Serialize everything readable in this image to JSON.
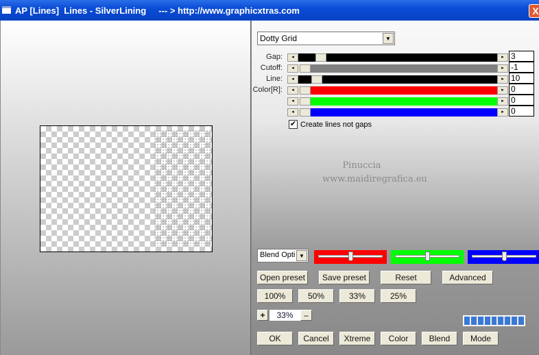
{
  "window": {
    "title": "AP [Lines]  Lines - SilverLining     --- > http://www.graphicxtras.com",
    "close": "X"
  },
  "preset": {
    "value": "Dotty Grid"
  },
  "sliders": [
    {
      "label": "Gap:",
      "value": "3",
      "color": "#000000",
      "thumb_pct": 8
    },
    {
      "label": "Cutoff:",
      "value": "-1",
      "color": "#808080",
      "thumb_pct": 0
    },
    {
      "label": "Line:",
      "value": "10",
      "color": "#000000",
      "thumb_pct": 6
    },
    {
      "label": "Color[R]:",
      "value": "0",
      "color": "#ff0000",
      "thumb_pct": 0
    },
    {
      "label": "",
      "value": "0",
      "color": "#00ff00",
      "thumb_pct": 0
    },
    {
      "label": "",
      "value": "0",
      "color": "#0000ff",
      "thumb_pct": 0
    }
  ],
  "checkbox": {
    "label": "Create lines not gaps",
    "checked": true
  },
  "watermark": {
    "line1": "Pinuccia",
    "line2": "www.maidiregrafica.eu"
  },
  "blend": {
    "value": "Blend Opti"
  },
  "color_sliders": [
    {
      "color": "#ff0000",
      "pct": 50
    },
    {
      "color": "#00ff00",
      "pct": 50
    },
    {
      "color": "#0000ff",
      "pct": 50
    }
  ],
  "buttons": {
    "open_preset": "Open preset",
    "save_preset": "Save preset",
    "reset": "Reset",
    "advanced": "Advanced"
  },
  "zoom_buttons": [
    "100%",
    "50%",
    "33%",
    "25%"
  ],
  "zoom": {
    "plus": "+",
    "value": "33%",
    "minus": "–"
  },
  "progress": {
    "segments": 9,
    "filled": 9
  },
  "bottom_buttons": [
    "OK",
    "Cancel",
    "Xtreme",
    "Color",
    "Blend",
    "Mode"
  ]
}
